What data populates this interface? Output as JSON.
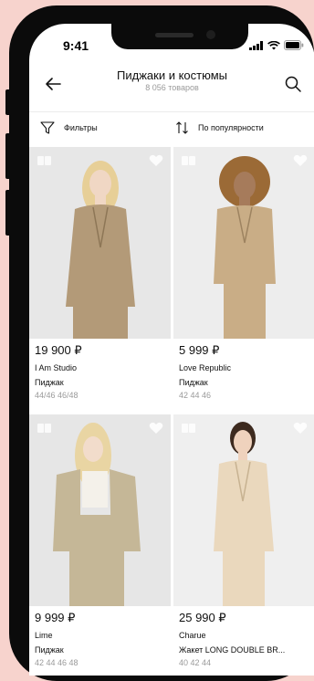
{
  "status": {
    "time": "9:41"
  },
  "header": {
    "title": "Пиджаки и костюмы",
    "subtitle": "8 056 товаров"
  },
  "toolbar": {
    "filters_label": "Фильтры",
    "sort_label": "По популярности"
  },
  "products": [
    {
      "price": "19 900 ₽",
      "brand": "I Am Studio",
      "type": "Пиджак",
      "sizes": "44/46 46/48",
      "bg": "#e7e7e7",
      "garment": "#b39a78",
      "skin": "#f0d7c4",
      "hair": "#e7cf97"
    },
    {
      "price": "5 999 ₽",
      "brand": "Love Republic",
      "type": "Пиджак",
      "sizes": "42 44 46",
      "bg": "#ededed",
      "garment": "#c9ad86",
      "skin": "#a67b5b",
      "hair": "#9b6a36"
    },
    {
      "price": "9 999 ₽",
      "brand": "Lime",
      "type": "Пиджак",
      "sizes": "42 44 46 48",
      "bg": "#e6e6e6",
      "garment": "#c5b797",
      "skin": "#f2dccb",
      "hair": "#e9d5a3"
    },
    {
      "price": "25 990 ₽",
      "brand": "Charue",
      "type": "Жакет LONG DOUBLE BR...",
      "sizes": "40 42 44",
      "bg": "#efefef",
      "garment": "#ead8bd",
      "skin": "#efd2bd",
      "hair": "#3d2a1f"
    }
  ]
}
